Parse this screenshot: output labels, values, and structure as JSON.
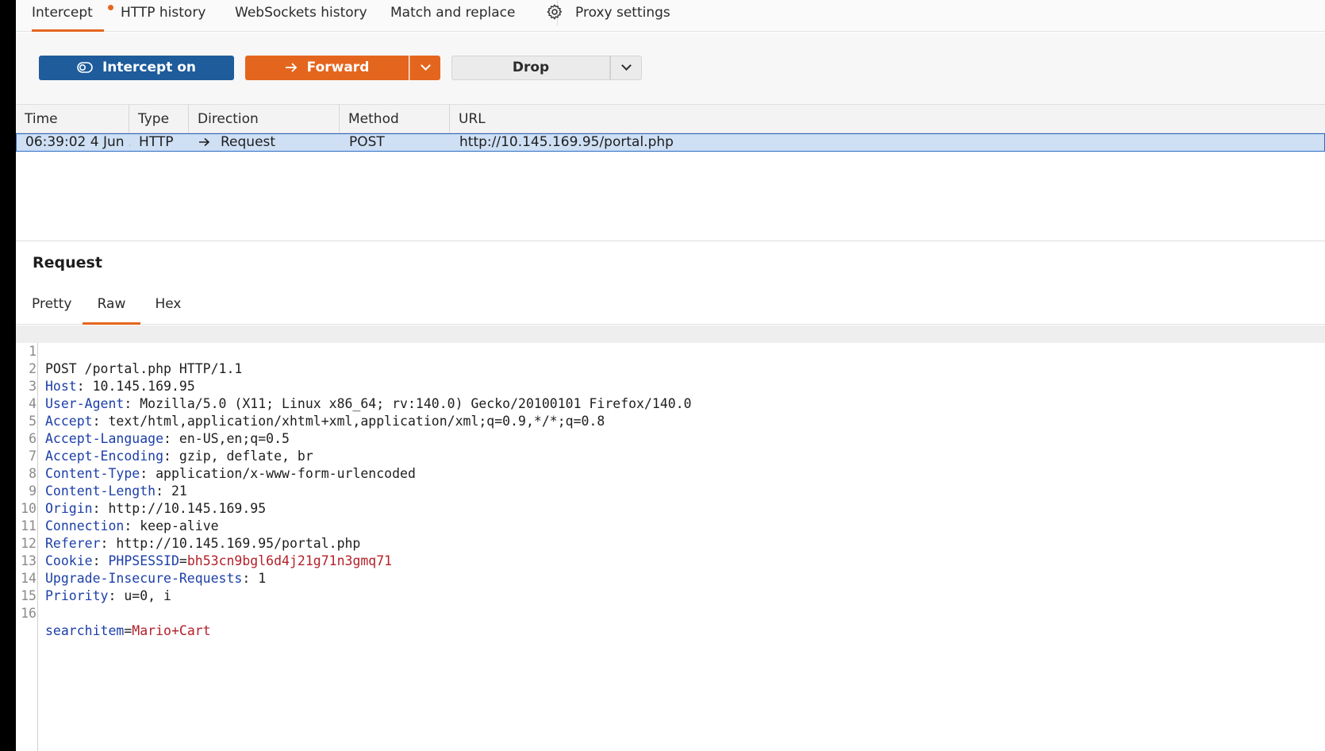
{
  "tabs": [
    {
      "label": "Intercept",
      "active": true,
      "has_dot": true
    },
    {
      "label": "HTTP history"
    },
    {
      "label": "WebSockets history"
    },
    {
      "label": "Match and replace"
    },
    {
      "label": "Proxy settings",
      "icon": "gear-icon"
    }
  ],
  "toolbar": {
    "intercept_label": "Intercept on",
    "forward_label": "Forward",
    "drop_label": "Drop",
    "colors": {
      "intercept": "#1e5c9c",
      "forward": "#e4661e"
    }
  },
  "table": {
    "columns": [
      "Time",
      "Type",
      "Direction",
      "Method",
      "URL"
    ],
    "rows": [
      {
        "time": "06:39:02 4 Jun ...",
        "type": "HTTP",
        "direction": "Request",
        "method": "POST",
        "url": "http://10.145.169.95/portal.php",
        "selected": true
      }
    ]
  },
  "request": {
    "title": "Request",
    "tabs": [
      "Pretty",
      "Raw",
      "Hex"
    ],
    "active_tab": "Raw",
    "lines": [
      {
        "n": "1",
        "text": "POST /portal.php HTTP/1.1"
      },
      {
        "n": "2",
        "key": "Host",
        "value": "10.145.169.95"
      },
      {
        "n": "3",
        "key": "User-Agent",
        "value": "Mozilla/5.0 (X11; Linux x86_64; rv:140.0) Gecko/20100101 Firefox/140.0"
      },
      {
        "n": "4",
        "key": "Accept",
        "value": "text/html,application/xhtml+xml,application/xml;q=0.9,*/*;q=0.8"
      },
      {
        "n": "5",
        "key": "Accept-Language",
        "value": "en-US,en;q=0.5"
      },
      {
        "n": "6",
        "key": "Accept-Encoding",
        "value": "gzip, deflate, br"
      },
      {
        "n": "7",
        "key": "Content-Type",
        "value": "application/x-www-form-urlencoded"
      },
      {
        "n": "8",
        "key": "Content-Length",
        "value": "21"
      },
      {
        "n": "9",
        "key": "Origin",
        "value": "http://10.145.169.95"
      },
      {
        "n": "10",
        "key": "Connection",
        "value": "keep-alive"
      },
      {
        "n": "11",
        "key": "Referer",
        "value": "http://10.145.169.95/portal.php"
      },
      {
        "n": "12",
        "key": "Cookie",
        "cookie_name": "PHPSESSID",
        "cookie_value": "bh53cn9bgl6d4j21g71n3gmq71"
      },
      {
        "n": "13",
        "key": "Upgrade-Insecure-Requests",
        "value": "1"
      },
      {
        "n": "14",
        "key": "Priority",
        "value": "u=0, i"
      },
      {
        "n": "15",
        "text": ""
      },
      {
        "n": "16",
        "param_name": "searchitem",
        "param_value": "Mario+Cart"
      }
    ]
  }
}
